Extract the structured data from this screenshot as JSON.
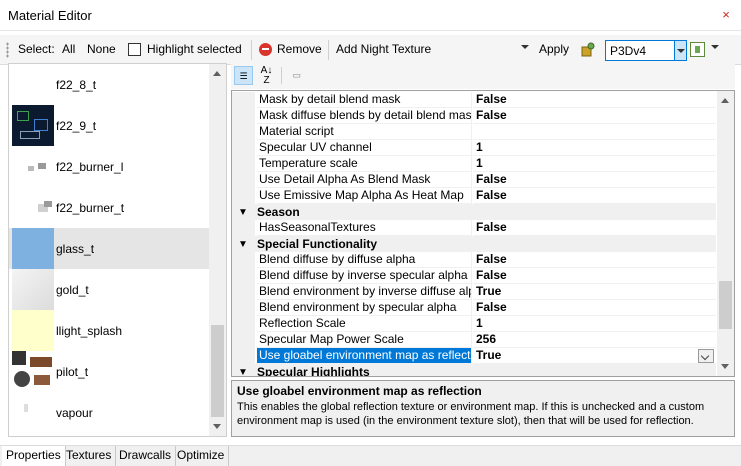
{
  "window": {
    "title": "Material Editor",
    "close_label": "×"
  },
  "toolbar": {
    "select_label": "Select:",
    "all_label": "All",
    "none_label": "None",
    "highlight_label": "Highlight selected",
    "remove_label": "Remove",
    "add_texture_label": "Add Night Texture",
    "apply_label": "Apply",
    "platform_value": "P3Dv4"
  },
  "textures": [
    {
      "label": "f22_8_t"
    },
    {
      "label": "f22_9_t"
    },
    {
      "label": "f22_burner_l"
    },
    {
      "label": "f22_burner_t"
    },
    {
      "label": "glass_t"
    },
    {
      "label": "gold_t"
    },
    {
      "label": "llight_splash"
    },
    {
      "label": "pilot_t"
    },
    {
      "label": "vapour"
    }
  ],
  "property_rows": [
    {
      "name": "Mask by detail blend mask",
      "value": "False"
    },
    {
      "name": "Mask diffuse blends by detail blend mask",
      "value": "False"
    },
    {
      "name": "Material script",
      "value": ""
    },
    {
      "name": "Specular UV channel",
      "value": "1"
    },
    {
      "name": "Temperature scale",
      "value": "1"
    },
    {
      "name": "Use Detail Alpha As Blend Mask",
      "value": "False"
    },
    {
      "name": "Use Emissive Map Alpha As Heat Map",
      "value": "False"
    },
    {
      "category": "Season"
    },
    {
      "name": "HasSeasonalTextures",
      "value": "False"
    },
    {
      "category": "Special Functionality"
    },
    {
      "name": "Blend diffuse by diffuse alpha",
      "value": "False"
    },
    {
      "name": "Blend diffuse by inverse specular alpha",
      "value": "False"
    },
    {
      "name": "Blend environment by inverse diffuse alpha",
      "value": "True"
    },
    {
      "name": "Blend environment by specular alpha",
      "value": "False"
    },
    {
      "name": "Reflection Scale",
      "value": "1"
    },
    {
      "name": "Specular Map Power Scale",
      "value": "256"
    },
    {
      "name": "Use gloabel environment map as reflection",
      "value": "True"
    },
    {
      "category": "Specular Highlights"
    }
  ],
  "description": {
    "title": "Use gloabel environment map as reflection",
    "text": "This enables the global reflection texture or environment map. If this is unchecked and a custom environment map is used (in the environment texture slot), then that will be used for reflection."
  },
  "tabs": [
    {
      "label": "Properties"
    },
    {
      "label": "Textures"
    },
    {
      "label": "Drawcalls"
    },
    {
      "label": "Optimize"
    }
  ],
  "colors": {
    "accent": "#0078d7",
    "selected_row": "#e5e5e5",
    "remove": "#d9342b"
  }
}
